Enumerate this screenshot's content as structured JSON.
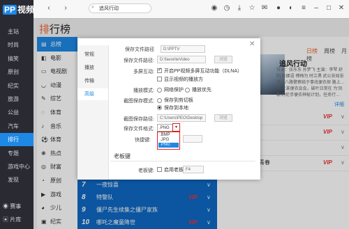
{
  "app": {
    "logo_badge": "PP",
    "logo_text": "视频"
  },
  "left_nav": {
    "items": [
      "主站",
      "时尚",
      "搞笑",
      "原创",
      "纪实",
      "旅游",
      "公益",
      "汽车",
      "排行",
      "专题",
      "游戏中心",
      "发现"
    ],
    "active": "排行",
    "footer": [
      "赛事",
      "片库"
    ]
  },
  "topbar": {
    "search_value": "追风行动"
  },
  "page": {
    "title_first": "排",
    "title_rest": "行榜"
  },
  "categories": [
    "总榜",
    "电影",
    "电视剧",
    "动漫",
    "综艺",
    "体育",
    "音乐",
    "体育",
    "热点",
    "财富",
    "原创",
    "游戏",
    "少儿",
    "纪实"
  ],
  "active_category": "总榜",
  "right_tabs": [
    "日榜",
    "周榜",
    "月榜"
  ],
  "featured": {
    "title": "追风行动",
    "info": "导演：张东东 孙梦飞 主演：李琴 舒阳 陈娜语 傅梅为 时江勇 武公安局张子…八路警察临于事找便衣探 路上…他 上某便衣会会，破叶日常在 为'凤歌'的伦手便衣神秘计划，任务行…",
    "detail_link": "详细"
  },
  "right_rows": [
    {
      "text": "",
      "vip": "VIP"
    },
    {
      "text": "",
      "vip": "VIP"
    },
    {
      "text": "天",
      "vip": ""
    },
    {
      "text": "粘青春",
      "vip": "VIP"
    }
  ],
  "bottom_list": [
    {
      "num": "7",
      "title": "一夜惊喜",
      "vip": ""
    },
    {
      "num": "8",
      "title": "特警队",
      "vip": "VIP"
    },
    {
      "num": "9",
      "title": "僵尸先生续集之僵尸家族",
      "vip": ""
    },
    {
      "num": "10",
      "title": "哪吒之魔童降世",
      "vip": "VIP"
    }
  ],
  "dialog": {
    "side": [
      "常规",
      "播放",
      "传输",
      "高级"
    ],
    "active_side": "高级",
    "row0_label": "保存文件路径",
    "row0_path": "D:\\PPTV",
    "download_path_label": "保存文件路径:",
    "download_path_value": "D:\\favoriteVideo",
    "browse_label": "浏览",
    "multiscreen_label": "多屏互动:",
    "multiscreen_opt1": "开启PP视频多屏互动功能（DLNA）",
    "multiscreen_opt2": "显示视频的播放方",
    "play_mode_label": "播放模式:",
    "play_mode_opt1": "网络保护",
    "play_mode_opt2": "播放优先",
    "snapshot_mode_label": "截图保存模式:",
    "snapshot_mode_opt1": "保存到剪切板",
    "snapshot_mode_opt2": "保存到本地",
    "snapshot_path_label": "截图保存路径:",
    "snapshot_path_value": "C:\\Users\\PEO\\Desktop",
    "format_label": "保存文件格式:",
    "format_value": ".PNG",
    "format_options": [
      ".BMP",
      ".JPG",
      ".PNG"
    ],
    "format_selected": ".PNG",
    "hotkey_label": "快捷键:",
    "section_boss_key": "老板键",
    "boss_key_label": "老板键:",
    "boss_key_opt": "启用老板键",
    "boss_key_value": "F4"
  }
}
